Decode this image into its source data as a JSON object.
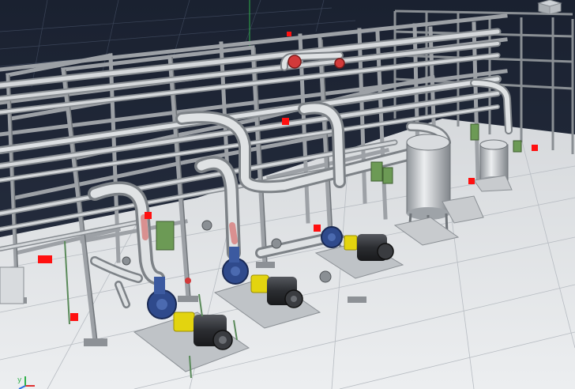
{
  "viewport": {
    "description_name": "3d-plant-model-viewport",
    "background_top": "#1a2130",
    "background_bottom": "#2a3244",
    "floor_color": "#e4e6e8",
    "floor_grid_color": "#b7bcc2",
    "frame_color": "#a7abb0",
    "frame_dark": "#6f7479",
    "pipe_color": "#c3c7cb",
    "pump_casing_color": "#2f4a8c",
    "motor_body_color": "#2b2d31",
    "coupling_guard_color": "#e3d40f",
    "valve_red": "#d23a3a",
    "marker_red": "#ff1010",
    "panel_green": "#6c9a55",
    "vessel_color": "#c9cdd1"
  },
  "axis_gizmo": {
    "y_label": "y",
    "x_color": "#e03131",
    "y_color": "#2fb04a",
    "z_color": "#2d6fe0"
  },
  "view_cube": {
    "icon": "view-cube-icon"
  }
}
